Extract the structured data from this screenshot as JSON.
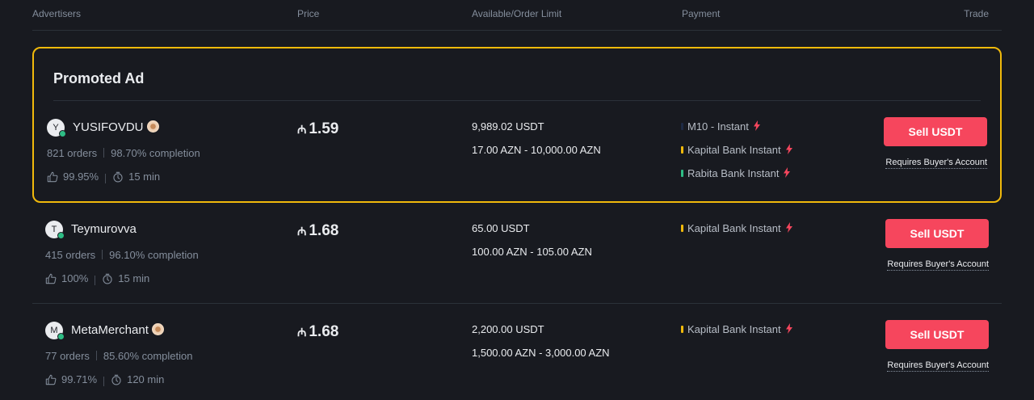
{
  "header": {
    "advertisers": "Advertisers",
    "price": "Price",
    "available": "Available/Order Limit",
    "payment": "Payment",
    "trade": "Trade"
  },
  "promoted": {
    "title": "Promoted Ad"
  },
  "ads": [
    {
      "avatar": "Y",
      "name": "YUSIFOVDU",
      "verified_badge": true,
      "orders": "821 orders",
      "completion": "98.70% completion",
      "positive_rate": "99.95%",
      "release_time": "15 min",
      "currency_symbol": "₼",
      "price": "1.59",
      "available": "9,989.02 USDT",
      "limit": "17.00 AZN - 10,000.00 AZN",
      "payments": [
        {
          "label": "M10 - Instant",
          "color": "#1e2a44"
        },
        {
          "label": "Kapital Bank Instant",
          "color": "#f0b90b"
        },
        {
          "label": "Rabita Bank Instant",
          "color": "#2ebd85"
        }
      ],
      "action": "Sell USDT",
      "requirement": "Requires Buyer's Account"
    },
    {
      "avatar": "T",
      "name": "Teymurovva",
      "verified_badge": false,
      "orders": "415 orders",
      "completion": "96.10% completion",
      "positive_rate": "100%",
      "release_time": "15 min",
      "currency_symbol": "₼",
      "price": "1.68",
      "available": "65.00 USDT",
      "limit": "100.00 AZN - 105.00 AZN",
      "payments": [
        {
          "label": "Kapital Bank Instant",
          "color": "#f0b90b"
        }
      ],
      "action": "Sell USDT",
      "requirement": "Requires Buyer's Account"
    },
    {
      "avatar": "M",
      "name": "MetaMerchant",
      "verified_badge": true,
      "orders": "77 orders",
      "completion": "85.60% completion",
      "positive_rate": "99.71%",
      "release_time": "120 min",
      "currency_symbol": "₼",
      "price": "1.68",
      "available": "2,200.00 USDT",
      "limit": "1,500.00 AZN - 3,000.00 AZN",
      "payments": [
        {
          "label": "Kapital Bank Instant",
          "color": "#f0b90b"
        }
      ],
      "action": "Sell USDT",
      "requirement": "Requires Buyer's Account"
    }
  ],
  "colors": {
    "background": "#181a20",
    "promo_border": "#f0b90b",
    "sell_button": "#f6465d",
    "online_dot": "#2ebd85",
    "bolt": "#f6465d"
  }
}
